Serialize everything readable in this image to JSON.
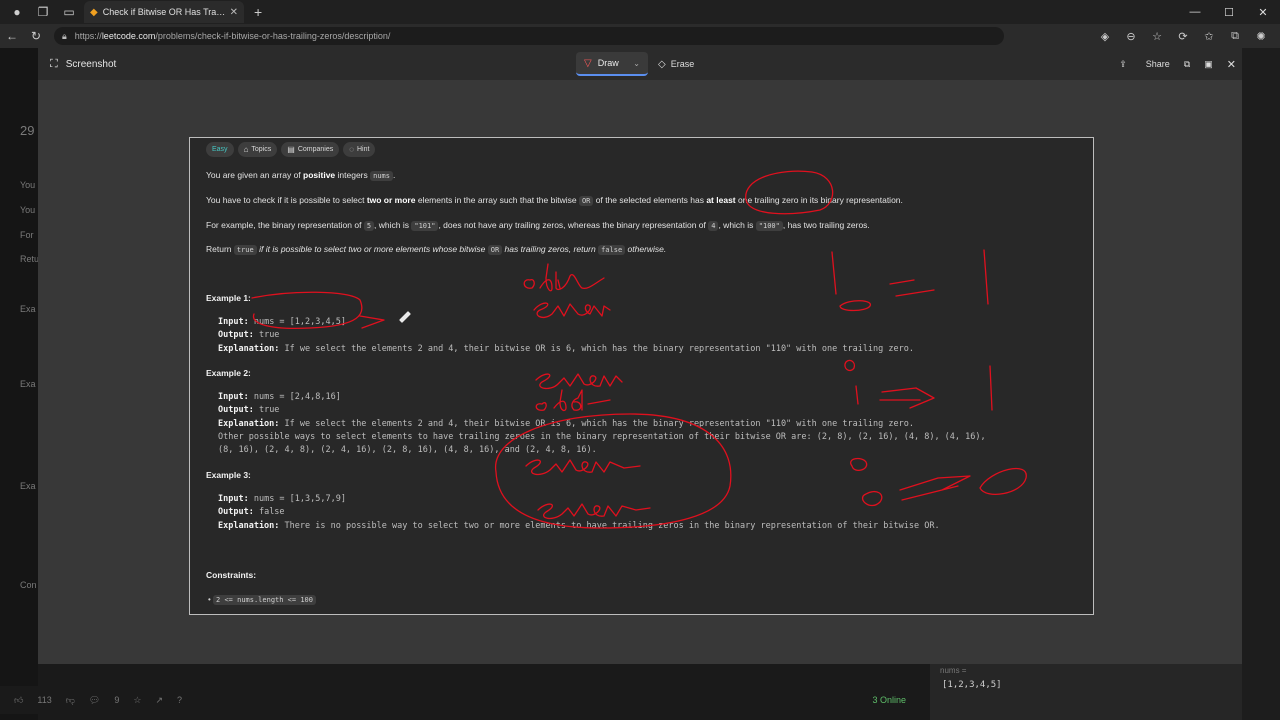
{
  "browser": {
    "tab_title": "Check if Bitwise OR Has Trailing Z...",
    "url_host": "leetcode.com",
    "url_prefix": "https://",
    "url_path": "/problems/check-if-bitwise-or-has-trailing-zeros/description/"
  },
  "behind": {
    "left_texts": [
      "29",
      "You",
      "You",
      "For",
      "Retu",
      "Exa",
      "Exa",
      "Exa",
      "Con"
    ],
    "likes": "113",
    "comments": "9",
    "online": "3 Online",
    "testcase_value": "[1,2,3,4,5]"
  },
  "overlay": {
    "title": "Screenshot",
    "draw_label": "Draw",
    "erase_label": "Erase",
    "share_label": "Share"
  },
  "problem": {
    "chips": [
      "Easy",
      "Topics",
      "Companies",
      "Hint"
    ],
    "line1_pre": "You are given an array of ",
    "line1_bold": "positive",
    "line1_mid": " integers ",
    "line1_code": "nums",
    "line1_end": ".",
    "line2_pre": "You have to check if it is possible to select ",
    "line2_bold": "two or more",
    "line2_mid": " elements in the array such that the bitwise ",
    "line2_code": "OR",
    "line2_mid2": " of the selected elements has ",
    "line2_bold2": "at least",
    "line2_end": " one trailing zero in its binary representation.",
    "line3_a": "For example, the binary representation of ",
    "line3_code1": "5",
    "line3_b": ", which is ",
    "line3_code2": "\"101\"",
    "line3_c": ", does not have any trailing zeros, whereas the binary representation of ",
    "line3_code3": "4",
    "line3_d": ", which is ",
    "line3_code4": "\"100\"",
    "line3_e": ", has two trailing zeros.",
    "line4_a": "Return ",
    "line4_code1": "true",
    "line4_b": " if it is possible to select two or more elements whose bitwise ",
    "line4_code2": "OR",
    "line4_c": " has trailing zeros, return ",
    "line4_code3": "false",
    "line4_d": " otherwise.",
    "examples": [
      {
        "title": "Example 1:",
        "input": "nums = [1,2,3,4,5]",
        "output": "true",
        "explanation": "If we select the elements 2 and 4, their bitwise OR is 6, which has the binary representation \"110\" with one trailing zero.",
        "extra": []
      },
      {
        "title": "Example 2:",
        "input": "nums = [2,4,8,16]",
        "output": "true",
        "explanation": "If we select the elements 2 and 4, their bitwise OR is 6, which has the binary representation \"110\" with one trailing zero.",
        "extra": [
          "Other possible ways to select elements to have trailing zeroes in the binary representation of their bitwise OR are: (2, 8), (2, 16), (4, 8), (4, 16),",
          "(8, 16), (2, 4, 8), (2, 4, 16), (2, 8, 16), (4, 8, 16), and (2, 4, 8, 16)."
        ]
      },
      {
        "title": "Example 3:",
        "input": "nums = [1,3,5,7,9]",
        "output": "false",
        "explanation": "There is no possible way to select two or more elements to have trailing zeros in the binary representation of their bitwise OR.",
        "extra": []
      }
    ],
    "labels": {
      "input": "Input:",
      "output": "Output:",
      "explanation": "Explanation:"
    },
    "constraints_title": "Constraints:",
    "constraint": "2 <= nums.length <= 100"
  },
  "colors": {
    "ink": "#e0101e",
    "accent": "#5b8ff0",
    "easy": "#46c6c2"
  },
  "icons": [
    "profile-icon",
    "collections-icon",
    "tab-actions-icon",
    "back-icon",
    "refresh-icon",
    "lock-icon",
    "screenshot-icon",
    "pen-icon",
    "eraser-icon",
    "share-icon",
    "copy-icon",
    "save-icon",
    "close-icon"
  ]
}
